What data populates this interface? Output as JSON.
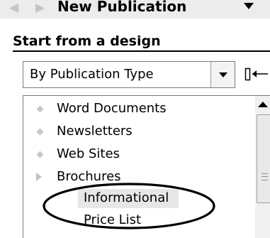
{
  "titlebar": {
    "title": "New Publication",
    "back_icon": "back-arrow-icon",
    "forward_icon": "forward-arrow-icon",
    "menu_icon": "dropdown-arrow-icon"
  },
  "section": {
    "header": "Start from a design"
  },
  "design_filter": {
    "selected": "By Publication Type",
    "button_icon": "dropdown-arrow-icon"
  },
  "pin_icon": "collapse-panel-icon",
  "publication_list": {
    "items": [
      {
        "label": "Word Documents",
        "icon": "bullet-icon"
      },
      {
        "label": "Newsletters",
        "icon": "bullet-icon"
      },
      {
        "label": "Web Sites",
        "icon": "bullet-icon"
      },
      {
        "label": "Brochures",
        "icon": "expander-icon"
      },
      {
        "label": "Informational",
        "icon": ""
      },
      {
        "label": "Price List",
        "icon": ""
      }
    ],
    "selected": "Informational"
  },
  "scrollbar": {
    "up_icon": "scroll-up-arrow-icon"
  },
  "colors": {
    "titlebar_bg": "#ececec",
    "selection_bg": "#e7e7e7",
    "bullet": "#c6c6c6",
    "annotation": "#000000"
  }
}
